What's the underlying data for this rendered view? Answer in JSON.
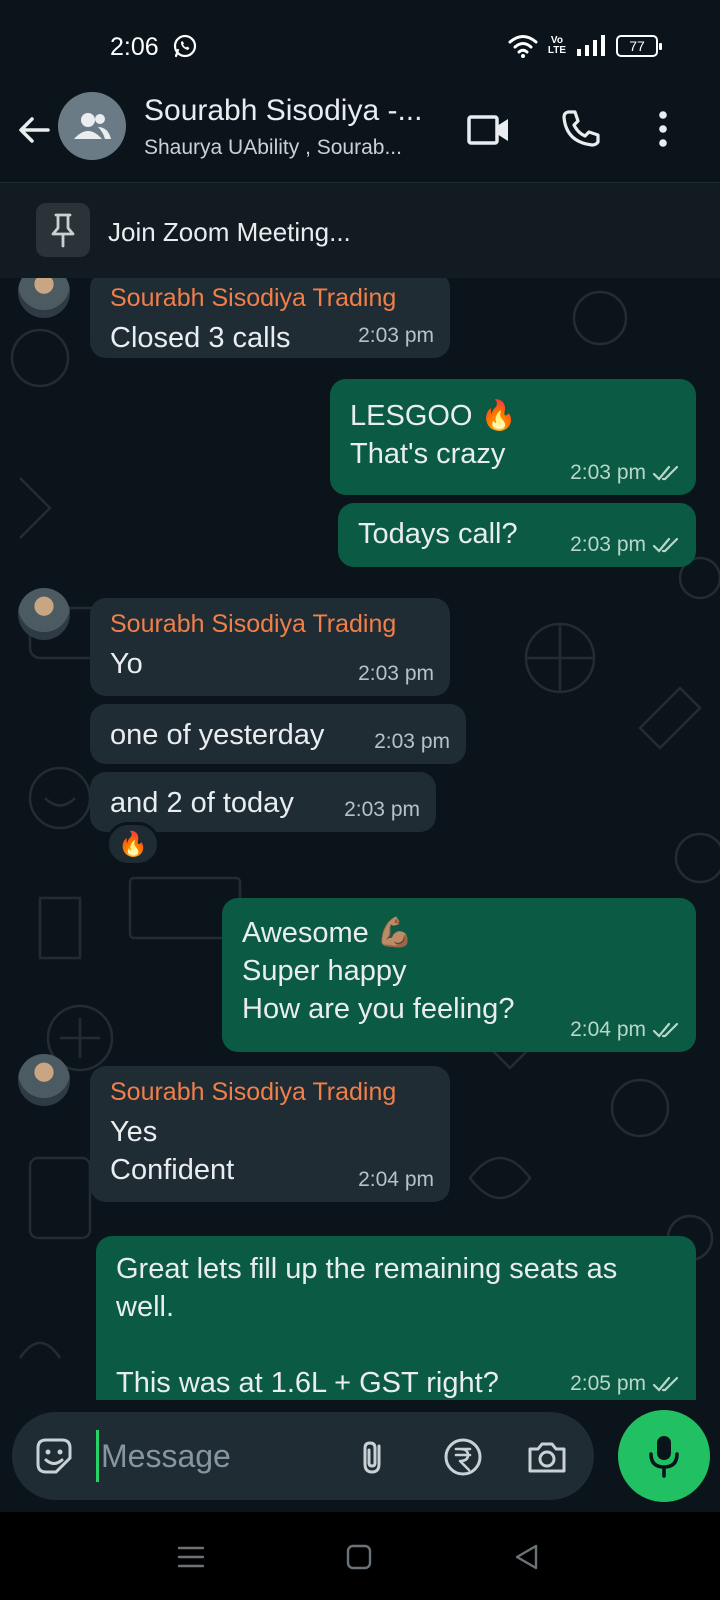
{
  "status_bar": {
    "time": "2:06",
    "battery": "77",
    "volte_top": "Vo",
    "volte_bottom": "LTE"
  },
  "header": {
    "title": "Sourabh Sisodiya -...",
    "subtitle": "Shaurya UAbility , Sourab..."
  },
  "pinned": {
    "text": "Join Zoom Meeting..."
  },
  "messages": [
    {
      "direction": "in",
      "sender": "Sourabh Sisodiya Trading",
      "text": "Closed 3 calls",
      "time": "2:03 pm"
    },
    {
      "direction": "out",
      "text": "LESGOO 🔥\nThat's crazy",
      "time": "2:03 pm",
      "read": true
    },
    {
      "direction": "out",
      "text": "Todays call?",
      "time": "2:03 pm",
      "read": true
    },
    {
      "direction": "in",
      "sender": "Sourabh Sisodiya Trading",
      "text": "Yo",
      "time": "2:03 pm"
    },
    {
      "direction": "in",
      "text": "one of yesterday",
      "time": "2:03 pm"
    },
    {
      "direction": "in",
      "text": "and 2 of today",
      "time": "2:03 pm",
      "reaction": "🔥"
    },
    {
      "direction": "out",
      "text": "Awesome 💪🏽\nSuper happy\nHow are you feeling?",
      "time": "2:04 pm",
      "read": true
    },
    {
      "direction": "in",
      "sender": "Sourabh Sisodiya Trading",
      "text": "Yes\nConfident",
      "time": "2:04 pm"
    },
    {
      "direction": "out",
      "text": "Great lets fill up the remaining seats as well.\n\nThis was at 1.6L + GST right?",
      "time": "2:05 pm",
      "read": true
    }
  ],
  "input": {
    "placeholder": "Message"
  },
  "colors": {
    "background": "#0b141a",
    "incoming_bubble": "#202c33",
    "outgoing_bubble": "#0b5a43",
    "sender_name": "#f07f4a",
    "accent": "#21c063"
  }
}
